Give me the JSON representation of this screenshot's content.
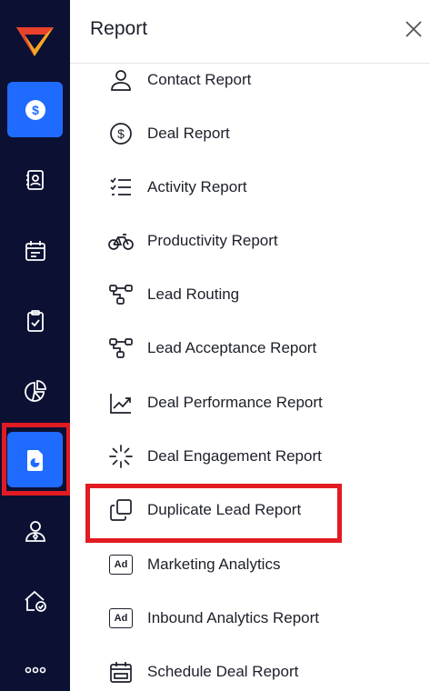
{
  "rail": {
    "logo_icon": "brand-logo",
    "items": [
      {
        "icon": "dollar-icon",
        "active": true
      },
      {
        "icon": "contact-card-icon",
        "active": false
      },
      {
        "icon": "calendar-icon",
        "active": false
      },
      {
        "icon": "clipboard-check-icon",
        "active": false
      },
      {
        "icon": "pie-chart-icon",
        "active": false
      },
      {
        "icon": "report-icon",
        "active": true
      },
      {
        "icon": "user-tie-icon",
        "active": false
      },
      {
        "icon": "home-check-icon",
        "active": false
      },
      {
        "icon": "more-icon",
        "active": false
      }
    ],
    "accent_color": "#1f6bff",
    "background_color": "#0c1133",
    "highlight_color": "#e21b23"
  },
  "panel": {
    "title": "Report",
    "close_icon": "close-icon",
    "items": [
      {
        "label": "Contact Report",
        "icon": "user-icon"
      },
      {
        "label": "Deal Report",
        "icon": "dollar-circle-icon"
      },
      {
        "label": "Activity Report",
        "icon": "checklist-icon"
      },
      {
        "label": "Productivity Report",
        "icon": "bicycle-icon"
      },
      {
        "label": "Lead Routing",
        "icon": "routing-icon"
      },
      {
        "label": "Lead Acceptance Report",
        "icon": "routing-icon"
      },
      {
        "label": "Deal Performance Report",
        "icon": "trend-chart-icon"
      },
      {
        "label": "Deal Engagement Report",
        "icon": "loader-icon"
      },
      {
        "label": "Duplicate Lead Report",
        "icon": "duplicate-icon",
        "highlighted": true
      },
      {
        "label": "Marketing Analytics",
        "icon": "ad-icon",
        "badge": "Ad"
      },
      {
        "label": "Inbound Analytics Report",
        "icon": "ad-icon",
        "badge": "Ad"
      },
      {
        "label": "Schedule Deal Report",
        "icon": "schedule-calendar-icon"
      }
    ]
  }
}
